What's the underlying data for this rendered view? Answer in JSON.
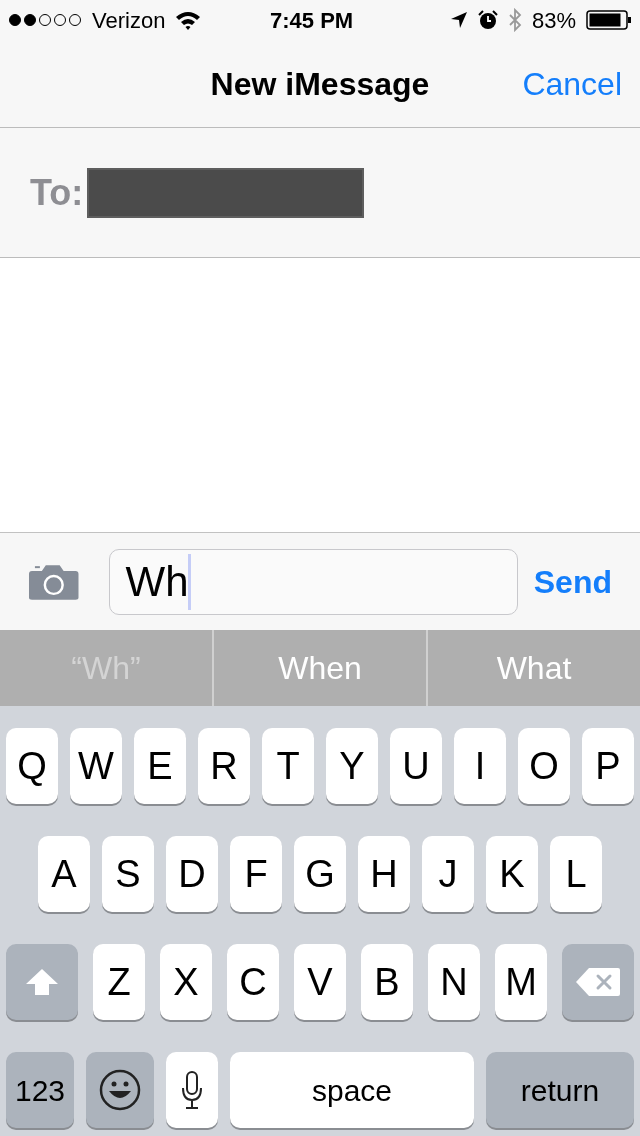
{
  "status_bar": {
    "carrier": "Verizon",
    "time": "7:45 PM",
    "battery": "83%"
  },
  "nav": {
    "title": "New iMessage",
    "cancel": "Cancel"
  },
  "recipient": {
    "label": "To:",
    "redacted": true
  },
  "compose": {
    "value": "Wh",
    "send": "Send"
  },
  "suggestions": [
    {
      "label": "“Wh”",
      "kind": "literal"
    },
    {
      "label": "When",
      "kind": "word"
    },
    {
      "label": "What",
      "kind": "word"
    }
  ],
  "keyboard": {
    "letter_row": [
      {
        "kind": "letter",
        "label": "Q"
      },
      {
        "kind": "letter",
        "label": "W"
      },
      {
        "kind": "letter",
        "label": "E"
      },
      {
        "kind": "letter",
        "label": "R"
      },
      {
        "kind": "letter",
        "label": "T"
      },
      {
        "kind": "letter",
        "label": "Y"
      },
      {
        "kind": "letter",
        "label": "U"
      },
      {
        "kind": "letter",
        "label": "I"
      },
      {
        "kind": "letter",
        "label": "O"
      },
      {
        "kind": "letter",
        "label": "P"
      }
    ],
    "home_row": [
      {
        "kind": "letter",
        "label": "A"
      },
      {
        "kind": "letter",
        "label": "S"
      },
      {
        "kind": "letter",
        "label": "D"
      },
      {
        "kind": "letter",
        "label": "F"
      },
      {
        "kind": "letter",
        "label": "G"
      },
      {
        "kind": "letter",
        "label": "H"
      },
      {
        "kind": "letter",
        "label": "J"
      },
      {
        "kind": "letter",
        "label": "K"
      },
      {
        "kind": "letter",
        "label": "L"
      }
    ],
    "shift_row": [
      {
        "kind": "shift"
      },
      {
        "kind": "letter",
        "label": "Z"
      },
      {
        "kind": "letter",
        "label": "X"
      },
      {
        "kind": "letter",
        "label": "C"
      },
      {
        "kind": "letter",
        "label": "V"
      },
      {
        "kind": "letter",
        "label": "B"
      },
      {
        "kind": "letter",
        "label": "N"
      },
      {
        "kind": "letter",
        "label": "M"
      },
      {
        "kind": "delete"
      }
    ],
    "function_row": [
      {
        "kind": "numbers",
        "label": "123"
      },
      {
        "kind": "emoji"
      },
      {
        "kind": "mic"
      },
      {
        "kind": "space",
        "label": "space"
      },
      {
        "kind": "return",
        "label": "return"
      }
    ]
  }
}
